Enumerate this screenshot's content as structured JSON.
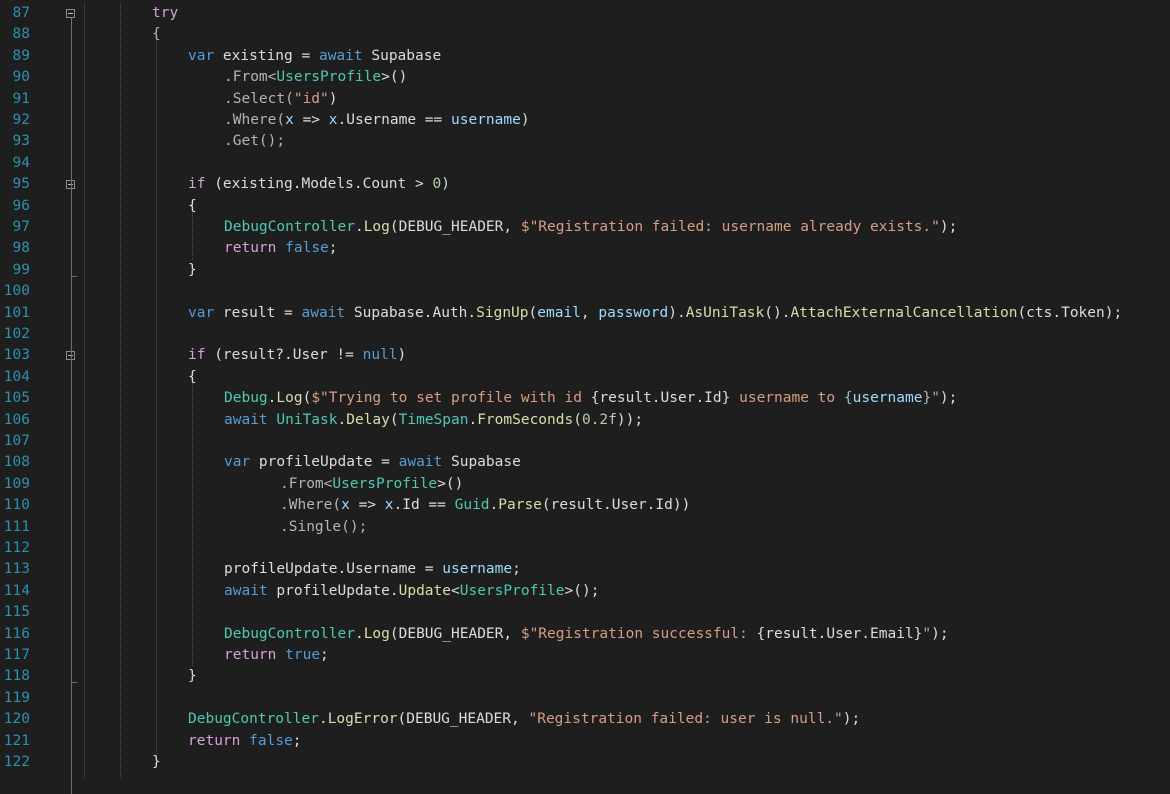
{
  "editor": {
    "lines": [
      {
        "num": "87",
        "indent": 0,
        "tokens": [
          {
            "t": "try",
            "c": "ctl"
          }
        ]
      },
      {
        "num": "88",
        "indent": 0,
        "tokens": [
          {
            "t": "{",
            "c": "op"
          }
        ]
      },
      {
        "num": "89",
        "indent": 1,
        "tokens": [
          {
            "t": "var",
            "c": "kw"
          },
          {
            "t": " existing = "
          },
          {
            "t": "await",
            "c": "kw"
          },
          {
            "t": " Supabase"
          }
        ]
      },
      {
        "num": "90",
        "indent": 2,
        "tokens": [
          {
            "t": ".From<",
            "c": "op"
          },
          {
            "t": "UsersProfile",
            "c": "type"
          },
          {
            "t": ">()"
          }
        ]
      },
      {
        "num": "91",
        "indent": 2,
        "tokens": [
          {
            "t": ".Select(",
            "c": "op"
          },
          {
            "t": "\"id\"",
            "c": "str"
          },
          {
            "t": ")"
          }
        ]
      },
      {
        "num": "92",
        "indent": 2,
        "tokens": [
          {
            "t": ".Where(",
            "c": "op"
          },
          {
            "t": "x",
            "c": "var"
          },
          {
            "t": " => "
          },
          {
            "t": "x",
            "c": "var"
          },
          {
            "t": ".Username == "
          },
          {
            "t": "username",
            "c": "var"
          },
          {
            "t": ")"
          }
        ]
      },
      {
        "num": "93",
        "indent": 2,
        "tokens": [
          {
            "t": ".Get();",
            "c": "op"
          }
        ]
      },
      {
        "num": "94",
        "indent": 0,
        "tokens": []
      },
      {
        "num": "95",
        "indent": 1,
        "tokens": [
          {
            "t": "if",
            "c": "ctl"
          },
          {
            "t": " (existing.Models.Count > "
          },
          {
            "t": "0",
            "c": "num"
          },
          {
            "t": ")"
          }
        ]
      },
      {
        "num": "96",
        "indent": 1,
        "tokens": [
          {
            "t": "{"
          }
        ]
      },
      {
        "num": "97",
        "indent": 2,
        "tokens": [
          {
            "t": "DebugController",
            "c": "type"
          },
          {
            "t": "."
          },
          {
            "t": "Log",
            "c": "method"
          },
          {
            "t": "(DEBUG_HEADER, "
          },
          {
            "t": "$\"Registration failed: username already exists.\"",
            "c": "str"
          },
          {
            "t": ");"
          }
        ]
      },
      {
        "num": "98",
        "indent": 2,
        "tokens": [
          {
            "t": "return",
            "c": "ctl"
          },
          {
            "t": " "
          },
          {
            "t": "false",
            "c": "kw"
          },
          {
            "t": ";"
          }
        ]
      },
      {
        "num": "99",
        "indent": 1,
        "tokens": [
          {
            "t": "}"
          }
        ]
      },
      {
        "num": "100",
        "indent": 0,
        "tokens": []
      },
      {
        "num": "101",
        "indent": 1,
        "tokens": [
          {
            "t": "var",
            "c": "kw"
          },
          {
            "t": " result = "
          },
          {
            "t": "await",
            "c": "kw"
          },
          {
            "t": " Supabase.Auth."
          },
          {
            "t": "SignUp",
            "c": "method"
          },
          {
            "t": "("
          },
          {
            "t": "email",
            "c": "var"
          },
          {
            "t": ", "
          },
          {
            "t": "password",
            "c": "var"
          },
          {
            "t": ")."
          },
          {
            "t": "AsUniTask",
            "c": "method"
          },
          {
            "t": "()."
          },
          {
            "t": "AttachExternalCancellation",
            "c": "method"
          },
          {
            "t": "(cts.Token);"
          }
        ]
      },
      {
        "num": "102",
        "indent": 0,
        "tokens": []
      },
      {
        "num": "103",
        "indent": 1,
        "tokens": [
          {
            "t": "if",
            "c": "ctl"
          },
          {
            "t": " (result?.User != "
          },
          {
            "t": "null",
            "c": "kw"
          },
          {
            "t": ")"
          }
        ]
      },
      {
        "num": "104",
        "indent": 1,
        "tokens": [
          {
            "t": "{"
          }
        ]
      },
      {
        "num": "105",
        "indent": 2,
        "tokens": [
          {
            "t": "Debug",
            "c": "type"
          },
          {
            "t": "."
          },
          {
            "t": "Log",
            "c": "method"
          },
          {
            "t": "("
          },
          {
            "t": "$\"Trying to set profile with id ",
            "c": "str"
          },
          {
            "t": "{result.User.Id}"
          },
          {
            "t": " username to ",
            "c": "str"
          },
          {
            "t": "{",
            "c": "op"
          },
          {
            "t": "username",
            "c": "var"
          },
          {
            "t": "}",
            "c": "op"
          },
          {
            "t": "\"",
            "c": "str"
          },
          {
            "t": ");"
          }
        ]
      },
      {
        "num": "106",
        "indent": 2,
        "tokens": [
          {
            "t": "await",
            "c": "kw"
          },
          {
            "t": " "
          },
          {
            "t": "UniTask",
            "c": "type"
          },
          {
            "t": "."
          },
          {
            "t": "Delay",
            "c": "method"
          },
          {
            "t": "("
          },
          {
            "t": "TimeSpan",
            "c": "type"
          },
          {
            "t": "."
          },
          {
            "t": "FromSeconds",
            "c": "method"
          },
          {
            "t": "("
          },
          {
            "t": "0.2f",
            "c": "num"
          },
          {
            "t": "));"
          }
        ]
      },
      {
        "num": "107",
        "indent": 0,
        "tokens": []
      },
      {
        "num": "108",
        "indent": 2,
        "tokens": [
          {
            "t": "var",
            "c": "kw"
          },
          {
            "t": " profileUpdate = "
          },
          {
            "t": "await",
            "c": "kw"
          },
          {
            "t": " Supabase"
          }
        ]
      },
      {
        "num": "109",
        "indent": 3,
        "tokens": [
          {
            "t": ".From<",
            "c": "op"
          },
          {
            "t": "UsersProfile",
            "c": "type"
          },
          {
            "t": ">()"
          }
        ]
      },
      {
        "num": "110",
        "indent": 3,
        "tokens": [
          {
            "t": ".Where(",
            "c": "op"
          },
          {
            "t": "x",
            "c": "var"
          },
          {
            "t": " => "
          },
          {
            "t": "x",
            "c": "var"
          },
          {
            "t": ".Id == "
          },
          {
            "t": "Guid",
            "c": "type"
          },
          {
            "t": "."
          },
          {
            "t": "Parse",
            "c": "method"
          },
          {
            "t": "(result.User.Id))"
          }
        ]
      },
      {
        "num": "111",
        "indent": 3,
        "tokens": [
          {
            "t": ".Single();",
            "c": "op"
          }
        ]
      },
      {
        "num": "112",
        "indent": 0,
        "tokens": []
      },
      {
        "num": "113",
        "indent": 2,
        "tokens": [
          {
            "t": "profileUpdate.Username = "
          },
          {
            "t": "username",
            "c": "var"
          },
          {
            "t": ";"
          }
        ]
      },
      {
        "num": "114",
        "indent": 2,
        "tokens": [
          {
            "t": "await",
            "c": "kw"
          },
          {
            "t": " profileUpdate."
          },
          {
            "t": "Update",
            "c": "method"
          },
          {
            "t": "<"
          },
          {
            "t": "UsersProfile",
            "c": "type"
          },
          {
            "t": ">();"
          }
        ]
      },
      {
        "num": "115",
        "indent": 0,
        "tokens": []
      },
      {
        "num": "116",
        "indent": 2,
        "tokens": [
          {
            "t": "DebugController",
            "c": "type"
          },
          {
            "t": "."
          },
          {
            "t": "Log",
            "c": "method"
          },
          {
            "t": "(DEBUG_HEADER, "
          },
          {
            "t": "$\"Registration successful: ",
            "c": "str"
          },
          {
            "t": "{result.User.Email}"
          },
          {
            "t": "\"",
            "c": "str"
          },
          {
            "t": ");"
          }
        ]
      },
      {
        "num": "117",
        "indent": 2,
        "tokens": [
          {
            "t": "return",
            "c": "ctl"
          },
          {
            "t": " "
          },
          {
            "t": "true",
            "c": "kw"
          },
          {
            "t": ";"
          }
        ]
      },
      {
        "num": "118",
        "indent": 1,
        "tokens": [
          {
            "t": "}"
          }
        ]
      },
      {
        "num": "119",
        "indent": 0,
        "tokens": []
      },
      {
        "num": "120",
        "indent": 1,
        "tokens": [
          {
            "t": "DebugController",
            "c": "type"
          },
          {
            "t": "."
          },
          {
            "t": "LogError",
            "c": "method"
          },
          {
            "t": "(DEBUG_HEADER, "
          },
          {
            "t": "\"Registration failed: user is null.\"",
            "c": "str"
          },
          {
            "t": ");"
          }
        ]
      },
      {
        "num": "121",
        "indent": 1,
        "tokens": [
          {
            "t": "return",
            "c": "ctl"
          },
          {
            "t": " "
          },
          {
            "t": "false",
            "c": "kw"
          },
          {
            "t": ";"
          }
        ]
      },
      {
        "num": "122",
        "indent": 0,
        "tokens": [
          {
            "t": "}"
          }
        ]
      }
    ]
  }
}
